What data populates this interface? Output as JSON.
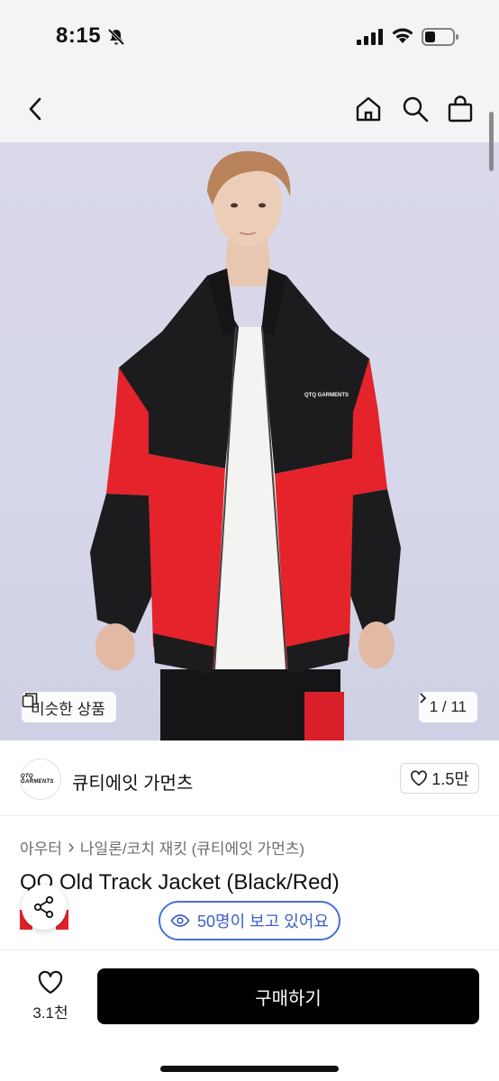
{
  "status_bar": {
    "time": "8:15"
  },
  "nav": {
    "icons": [
      "back-icon",
      "home-icon",
      "search-icon",
      "shopping-bag-icon"
    ]
  },
  "hero": {
    "similar_label": "비슷한 상품",
    "page_indicator": "1 / 11",
    "jacket_print": "QTQ GARMENTS"
  },
  "brand": {
    "logo_text": "QTQ GARMENTS",
    "name": "큐티에잇 가먼츠",
    "likes": "1.5만"
  },
  "product": {
    "breadcrumb": [
      "아우터",
      "나일론/코치 재킷 (큐티에잇 가먼츠)"
    ],
    "title": "QQ Old Track Jacket (Black/Red)",
    "viewers": "50명이 보고 있어요"
  },
  "action_bar": {
    "wish_count": "3.1천",
    "buy_label": "구매하기"
  },
  "colors": {
    "accent_blue": "#3b5fc7",
    "jacket_red": "#e5232b",
    "jacket_black": "#1c1c1e",
    "buy_button": "#000000"
  }
}
